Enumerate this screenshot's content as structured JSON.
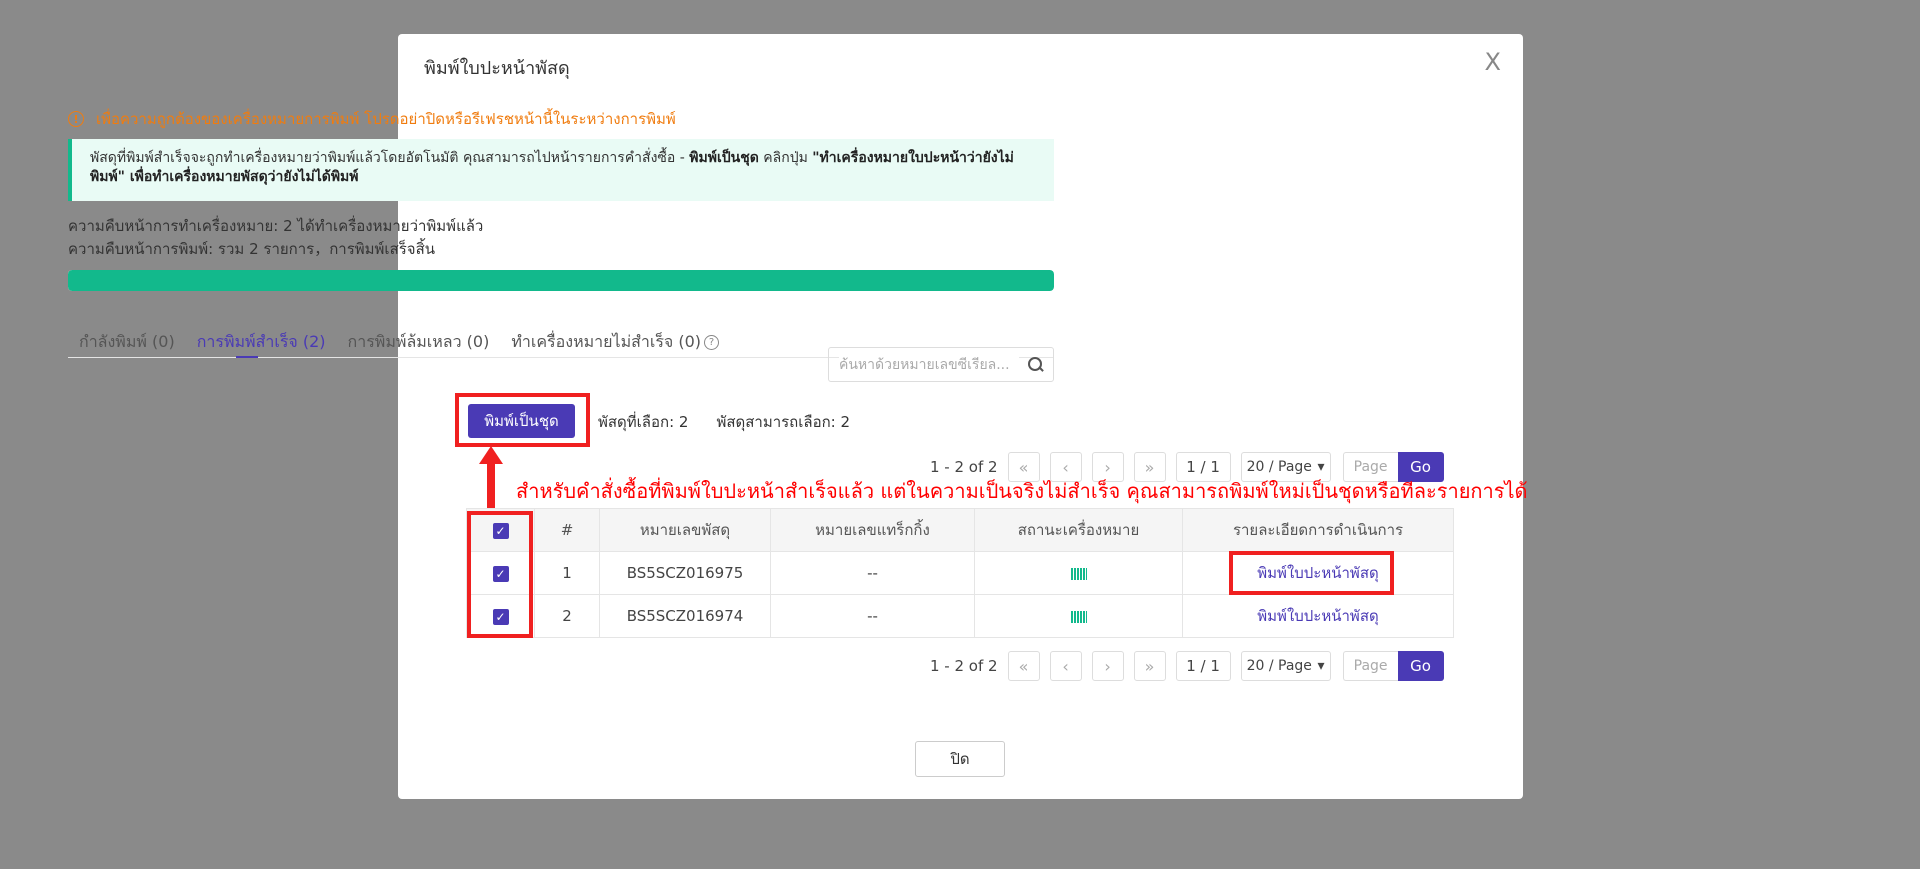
{
  "modal": {
    "title": "พิมพ์ใบปะหน้าพัสดุ",
    "close_icon": "X",
    "warning": "เพื่อความถูกต้องของเครื่องหมายการพิมพ์ โปรดอย่าปิดหรือรีเฟรชหน้านี้ในระหว่างการพิมพ์",
    "info": {
      "part1": "พัสดุที่พิมพ์สำเร็จจะถูกทำเครื่องหมายว่าพิมพ์แล้วโดยอัตโนมัติ คุณสามารถไปหน้ารายการคำสั่งซื้อ - ",
      "bold1": "พิมพ์เป็นชุด",
      "part2": " คลิกปุ่ม ",
      "bold2": "\"ทำเครื่องหมายใบปะหน้าว่ายังไม่พิมพ์\" เพื่อทำเครื่องหมายพัสดุว่ายังไม่ได้พิมพ์"
    },
    "progress_mark": "ความคืบหน้าการทำเครื่องหมาย: 2 ได้ทำเครื่องหมายว่าพิมพ์แล้ว",
    "progress_print": "ความคืบหน้าการพิมพ์: รวม 2 รายการ，การพิมพ์เสร็จสิ้น",
    "progress_percent": 100,
    "tabs": [
      {
        "label": "กำลังพิมพ์ (0)"
      },
      {
        "label": "การพิมพ์สำเร็จ (2)"
      },
      {
        "label": "การพิมพ์ล้มเหลว (0)"
      },
      {
        "label": "ทำเครื่องหมายไม่สำเร็จ (0)"
      }
    ],
    "help_icon": "?",
    "search_placeholder": "ค้นหาด้วยหมายเลขซีเรียล...",
    "batch_button": "พิมพ์เป็นชุด",
    "selected_info": "พัสดุที่เลือก: 2",
    "selectable_info": "พัสดุสามารถเลือก: 2",
    "pager": {
      "count": "1 - 2 of 2",
      "first": "«",
      "prev": "‹",
      "next": "›",
      "last": "»",
      "page_display": "1 / 1",
      "page_size": "20 / Page",
      "page_placeholder": "Page",
      "go": "Go"
    },
    "annotation": "สำหรับคำสั่งซื้อที่พิมพ์ใบปะหน้าสำเร็จแล้ว แต่ในความเป็นจริงไม่สำเร็จ คุณสามารถพิมพ์ใหม่เป็นชุดหรือทีละรายการได้",
    "table": {
      "headers": [
        "#",
        "หมายเลขพัสดุ",
        "หมายเลขแทร็กกิ้ง",
        "สถานะเครื่องหมาย",
        "รายละเอียดการดำเนินการ"
      ],
      "rows": [
        {
          "index": "1",
          "parcel": "BS5SCZ016975",
          "tracking": "--",
          "action": "พิมพ์ใบปะหน้าพัสดุ"
        },
        {
          "index": "2",
          "parcel": "BS5SCZ016974",
          "tracking": "--",
          "action": "พิมพ์ใบปะหน้าพัสดุ"
        }
      ]
    },
    "close_button": "ปิด"
  },
  "colors": {
    "accent": "#4a3ab5",
    "success": "#12b98c",
    "warning": "#f07c0f",
    "annotation": "#ff0000"
  }
}
